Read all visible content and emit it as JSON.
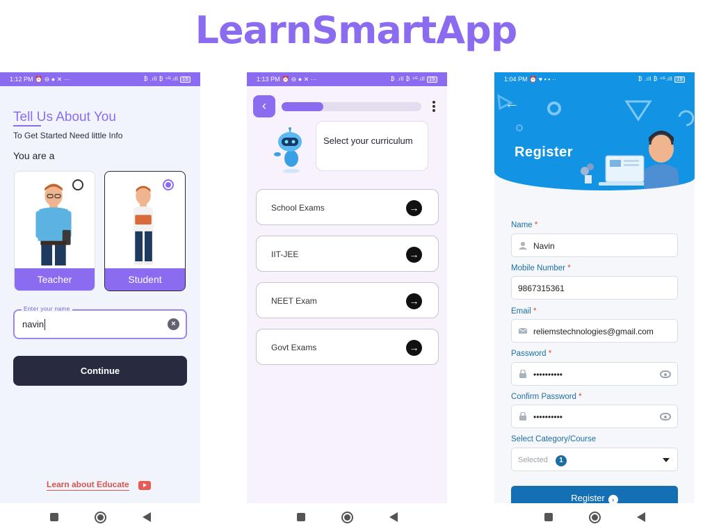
{
  "app_title": "LearnSmartApp",
  "colors": {
    "accent": "#8b6cf0",
    "dark": "#282a40",
    "blue": "#1393e4",
    "link": "#d45650"
  },
  "screen1": {
    "status_time": "1:12 PM",
    "status_right": "₿ .ıll ₿ ⁴ᴳ.ıll",
    "battery": "15",
    "heading": "Tell Us About You",
    "subheading": "To Get Started Need little Info",
    "you_are": "You are a",
    "roles": [
      {
        "label": "Teacher",
        "selected": false
      },
      {
        "label": "Student",
        "selected": true
      }
    ],
    "name_label": "Enter your name",
    "name_value": "navin",
    "continue_label": "Continue",
    "learn_link": "Learn about Educate"
  },
  "screen2": {
    "status_time": "1:13 PM",
    "status_right": "₿ .ıll ₿ ⁴ᴳ.ıll",
    "battery": "15",
    "progress": 0.3,
    "prompt": "Select your curriculum",
    "exams": [
      "School Exams",
      "IIT-JEE",
      "NEET Exam",
      "Govt Exams"
    ]
  },
  "screen3": {
    "status_time": "1:04 PM",
    "status_right": "₿ .ıll ₿ ⁴ᴳ.ıll",
    "battery": "19",
    "title": "Register",
    "fields": {
      "name_label": "Name",
      "name_value": "Navin",
      "mobile_label": "Mobile Number",
      "mobile_value": "9867315361",
      "email_label": "Email",
      "email_value": "reliemstechnologies@gmail.com",
      "password_label": "Password",
      "password_value": "••••••••••",
      "confirm_label": "Confirm Password",
      "confirm_value": "••••••••••",
      "category_label": "Select Category/Course",
      "category_placeholder": "Selected",
      "category_count": "1"
    },
    "required_mark": "*",
    "register_label": "Register"
  }
}
